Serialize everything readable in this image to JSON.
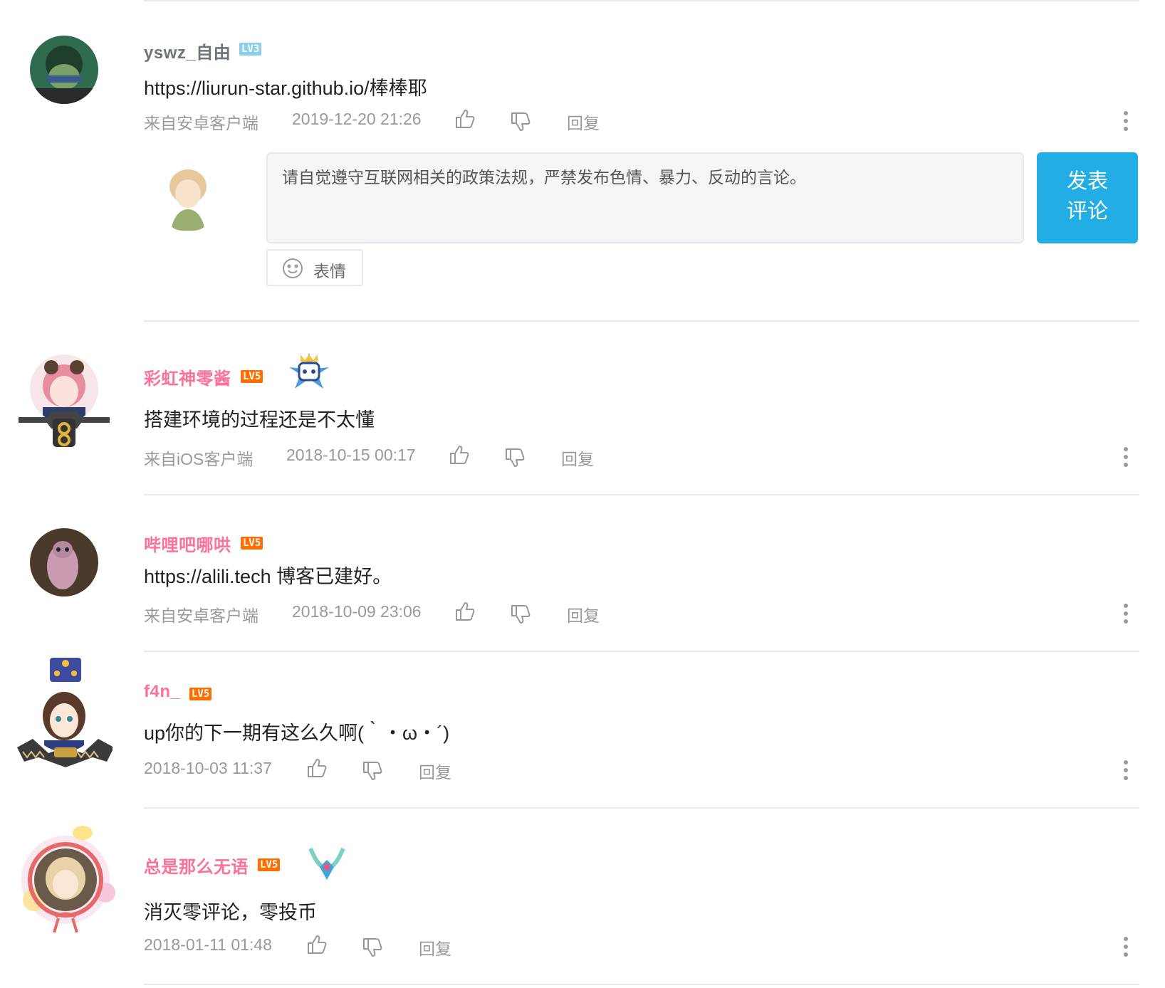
{
  "comments": [
    {
      "username": "yswz_自由",
      "level": "LV3",
      "text": "https://liurun-star.github.io/棒棒耶",
      "source": "来自安卓客户端",
      "time": "2019-12-20 21:26",
      "reply": "回复"
    },
    {
      "username": "彩虹神零酱",
      "level": "LV5",
      "text": "搭建环境的过程还是不太懂",
      "source": "来自iOS客户端",
      "time": "2018-10-15 00:17",
      "reply": "回复"
    },
    {
      "username": "哔哩吧哪哄",
      "level": "LV5",
      "text": "https://alili.tech 博客已建好。",
      "source": "来自安卓客户端",
      "time": "2018-10-09 23:06",
      "reply": "回复"
    },
    {
      "username": "f4n_",
      "level": "LV5",
      "text": "up你的下一期有这么久啊(｀・ω・´)",
      "source": "",
      "time": "2018-10-03 11:37",
      "reply": "回复"
    },
    {
      "username": "总是那么无语",
      "level": "LV5",
      "text": "消灭零评论，零投币",
      "source": "",
      "time": "2018-01-11 01:48",
      "reply": "回复"
    }
  ],
  "reply_box": {
    "placeholder": "请自觉遵守互联网相关的政策法规，严禁发布色情、暴力、反动的言论。",
    "submit_line1": "发表",
    "submit_line2": "评论",
    "emoji_label": "表情"
  },
  "colors": {
    "vip_name": "#fb7299",
    "normal_name": "#6d757a",
    "accent": "#23ade5",
    "meta": "#999999"
  }
}
